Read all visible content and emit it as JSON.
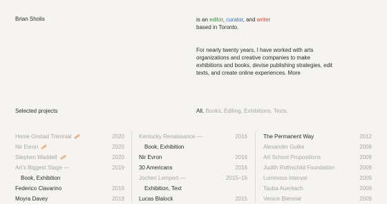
{
  "header": {
    "name": "Brian Sholis",
    "intro_prefix": "is an ",
    "role_editor": "editor",
    "comma_1": ", ",
    "role_curator": "curator",
    "comma_2": ", and ",
    "role_writer": "writer",
    "location": "based in Toronto."
  },
  "bio": {
    "line1": "For nearly twenty years, I have worked with arts",
    "line2": "organizations and creative companies to make",
    "line3": "exhibitions and books, devise publishing strategies, edit",
    "line4_prefix": "texts, and create online experiences. ",
    "more_link": "More"
  },
  "selected": {
    "label": "Selected projects",
    "filter_all": "All",
    "filter_comma": ",",
    "filter_books": " Books,",
    "filter_editing": " Editing,",
    "filter_exhibitions": " Exhibitions,",
    "filter_texts": " Texts."
  },
  "colors": {
    "editor": "#4a8a47",
    "curator": "#3d6fb0",
    "writer": "#c24b3a",
    "pencil_icon": "#e7b98e"
  },
  "projects": {
    "col1": [
      {
        "name": "Henie Onstad Triennial",
        "year": "2020",
        "icon": "pencil-icon"
      },
      {
        "name": "Nir Evron",
        "year": "2020",
        "icon": "pencil-icon"
      },
      {
        "name": "Stephen Waddell",
        "year": "2020",
        "icon": "pencil-icon"
      },
      {
        "name": "Art’s Biggest Stage —",
        "year": "2019"
      },
      {
        "name": "Book, Exhibition"
      },
      {
        "name": "Federico Clavarino",
        "year": "2019"
      },
      {
        "name": "Moyra Davey",
        "year": "2019"
      }
    ],
    "col2": [
      {
        "name": "Kentucky Renaissance —",
        "year": "2016"
      },
      {
        "name": "Book, Exhibition"
      },
      {
        "name": "Nir Evron",
        "year": "2016"
      },
      {
        "name": "30 Americans",
        "year": "2016"
      },
      {
        "name": "Jochen Lempert —",
        "year": "2015–16"
      },
      {
        "name": "Exhibition, Text"
      },
      {
        "name": "Lucas Blalock",
        "year": "2015"
      }
    ],
    "col3": [
      {
        "name": "The Permanent Way",
        "year": "2012"
      },
      {
        "name": "Alexander Gutke",
        "year": "2009"
      },
      {
        "name": "Art School Propositions",
        "year": "2009"
      },
      {
        "name": "Judith Rothschild Foundation",
        "year": "2009"
      },
      {
        "name": "Luminous Interval",
        "year": "2009"
      },
      {
        "name": "Tauba Auerbach",
        "year": "2009"
      },
      {
        "name": "Venice Biennial",
        "year": "2009"
      }
    ]
  }
}
